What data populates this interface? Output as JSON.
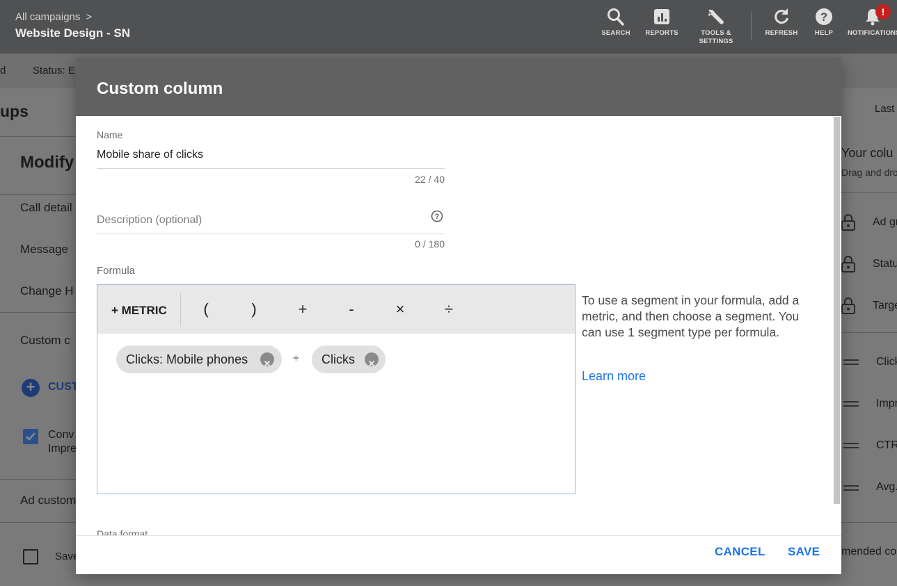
{
  "topbar": {
    "breadcrumb": "All campaigns",
    "campaign_name": "Website Design - SN",
    "buttons": {
      "search": "SEARCH",
      "reports": "REPORTS",
      "tools_line1": "TOOLS &",
      "tools_line2": "SETTINGS",
      "refresh": "REFRESH",
      "help": "HELP",
      "notifications": "NOTIFICATIONS"
    },
    "notification_badge": "!"
  },
  "background": {
    "status_label": "Status: E",
    "left_cut": "d",
    "section_title": "ups",
    "last_label": "Last",
    "modify_title": "Modify",
    "left_items": [
      "Call detail",
      "Message",
      "Change H"
    ],
    "custom_columns_label": "Custom c",
    "custom_button": "CUST",
    "conv_line1": "Conv",
    "conv_line2": "Impre",
    "ad_customizers": "Ad custom",
    "save_label": "Save",
    "your_columns_title": "Your colu",
    "your_columns_sub": "Drag and dro",
    "locked_columns": [
      "Ad gr",
      "Statu",
      "Targe"
    ],
    "draggable_columns": [
      "Click",
      "Impr",
      "CTR",
      "Avg."
    ],
    "recommended": "mended co"
  },
  "modal": {
    "title": "Custom column",
    "name": {
      "label": "Name",
      "value": "Mobile share of clicks",
      "counter": "22 / 40"
    },
    "description": {
      "placeholder": "Description (optional)",
      "counter": "0 / 180"
    },
    "formula": {
      "label": "Formula",
      "toolbar": {
        "metric": "+ METRIC",
        "open_paren": "(",
        "close_paren": ")",
        "plus": "+",
        "minus": "-",
        "times": "×",
        "divide": "÷"
      },
      "chips": [
        "Clicks: Mobile phones",
        "Clicks"
      ],
      "operator": "÷"
    },
    "info_text": "To use a segment in your formula, add a metric, and then choose a segment. You can use 1 segment type per formula.",
    "learn_more": "Learn more",
    "data_format_label": "Data format",
    "cancel": "CANCEL",
    "save": "SAVE"
  },
  "colors": {
    "accent": "#1a73e8",
    "header": "#616161",
    "topbar": "#505152"
  }
}
